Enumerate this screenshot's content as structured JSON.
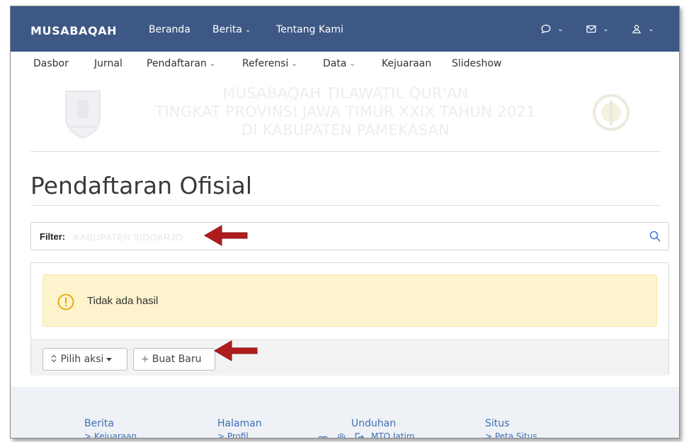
{
  "navbar": {
    "brand": "MUSABAQAH",
    "items": [
      {
        "label": "Beranda"
      },
      {
        "label": "Berita",
        "chevron": "⌵"
      },
      {
        "label": "Tentang Kami"
      }
    ],
    "icons": [
      "chat-icon",
      "mail-icon",
      "user-icon"
    ]
  },
  "submenu": {
    "items": [
      {
        "label": "Dasbor"
      },
      {
        "label": "Jurnal"
      },
      {
        "label": "Pendaftaran",
        "chevron": "⌵"
      },
      {
        "label": "Referensi",
        "chevron": "⌵"
      },
      {
        "label": "Data",
        "chevron": "⌵"
      },
      {
        "label": "Kejuaraan"
      },
      {
        "label": "Slideshow"
      }
    ]
  },
  "banner": {
    "line1": "MUSABAQAH TILAWATIL QUR'AN",
    "line2": "TINGKAT PROVINSI JAWA TIMUR XXIX TAHUN 2021",
    "line3": "DI KABUPATEN PAMEKASAN"
  },
  "page": {
    "title": "Pendaftaran Ofisial"
  },
  "filter": {
    "label": "Filter:",
    "value": "KABUPATEN SIDOARJO"
  },
  "results": {
    "empty_message": "Tidak ada hasil",
    "actions_label": "Pilih aksi",
    "create_label": "Buat Baru",
    "create_prefix": "+"
  },
  "footer": {
    "columns": [
      {
        "head": "Berita",
        "link": "> Kejuaraan"
      },
      {
        "head": "Halaman",
        "link": "> Profil"
      },
      {
        "head": "Unduhan",
        "link": "MTQ Jatim"
      },
      {
        "head": "Situs",
        "link": "> Peta Situs"
      }
    ]
  },
  "colors": {
    "navbar": "#3d5885",
    "alert_bg": "#fdf3cd",
    "annotation_arrow": "#b01c1c",
    "link": "#3f6fb4"
  }
}
